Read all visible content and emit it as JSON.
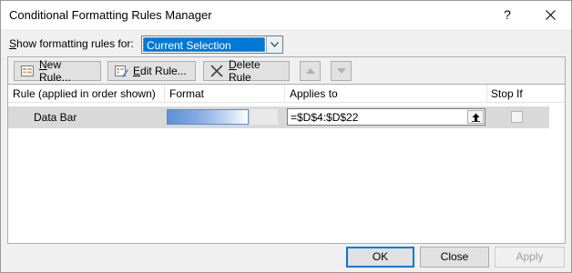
{
  "window": {
    "title": "Conditional Formatting Rules Manager",
    "help_glyph": "?"
  },
  "show_rules": {
    "label_prefix": "S",
    "label_rest": "how formatting rules for:",
    "selected_value": "Current Selection"
  },
  "toolbar": {
    "new_rule_label": "New Rule...",
    "new_rule_mnemonic": "N",
    "new_rule_rest": "ew Rule...",
    "edit_rule_mnemonic": "E",
    "edit_rule_rest": "dit Rule...",
    "delete_rule_mnemonic": "D",
    "delete_rule_rest": "elete Rule"
  },
  "grid": {
    "headers": {
      "rule": "Rule (applied in order shown)",
      "format": "Format",
      "applies_to": "Applies to",
      "stop_if_true": "Stop If True"
    },
    "rows": [
      {
        "rule": "Data Bar",
        "applies_to": "=$D$4:$D$22",
        "stop_if_true": false,
        "bar_color": "#5e8fd6"
      }
    ]
  },
  "footer": {
    "ok_label": "OK",
    "close_label": "Close",
    "apply_label": "Apply"
  },
  "colors": {
    "selection": "#0078d7",
    "row_selected": "#d9d9d9"
  }
}
